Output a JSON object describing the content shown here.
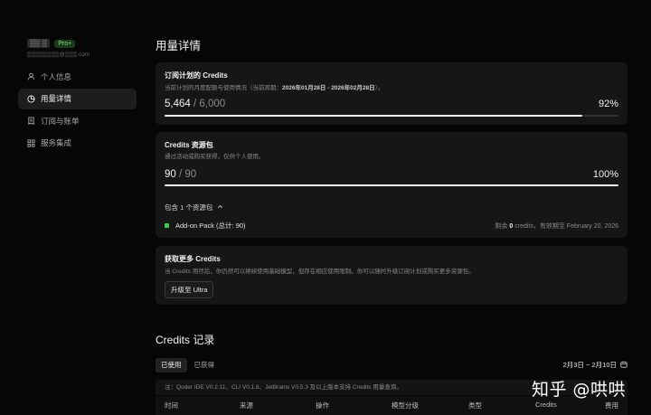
{
  "user": {
    "name": "▒▒ ▒",
    "plan_badge": "Pro+",
    "email": "▒▒▒▒▒▒▒▒@▒▒▒.com"
  },
  "nav": [
    {
      "label": "个人信息",
      "icon": "user-icon",
      "active": false
    },
    {
      "label": "用量详情",
      "icon": "pie-chart-icon",
      "active": true
    },
    {
      "label": "订阅与账单",
      "icon": "receipt-icon",
      "active": false
    },
    {
      "label": "服务集成",
      "icon": "grid-icon",
      "active": false
    }
  ],
  "page_title": "用量详情",
  "plan_card": {
    "title": "订阅计划的 Credits",
    "subtitle": "当前计划的月度配额与使用情况（当前周期：",
    "period": "2026年01月28日 - 2026年02月28日",
    "subtitle_end": "）。",
    "used": "5,464",
    "total": "/ 6,000",
    "percent": "92%",
    "progress": 0.92
  },
  "pack_card": {
    "title": "Credits 资源包",
    "subtitle": "通过活动或购买获得，仅供个人使用。",
    "used": "90",
    "total": "/ 90",
    "percent": "100%",
    "progress": 1.0,
    "toggle_label": "包含 1 个资源包",
    "pack_name": "Add-on Pack (总计: 90)",
    "remaining_prefix": "剩余",
    "remaining_value": "0",
    "remaining_suffix": "credits，有效期至 February 20, 2026"
  },
  "more_card": {
    "title": "获取更多 Credits",
    "subtitle": "当 Credits 用尽后，你仍然可以继续使用基础模型，但存在相应使用限制。你可以随时升级订阅计划或购买更多资源包。",
    "button": "升级至 Ultra"
  },
  "records": {
    "title": "Credits 记录",
    "tabs": [
      "已使用",
      "已获得"
    ],
    "active_tab": 0,
    "date_range": "2月3日 ~ 2月10日",
    "note": "注：Qoder IDE V0.2.11、CLI V0.1.8、JetBrains V0.5.3 及以上版本支持 Credits 用量查询。",
    "columns": [
      "时间",
      "来源",
      "操作",
      "模型分级",
      "类型",
      "Credits",
      "费用"
    ]
  },
  "watermark": "知乎 @哄哄"
}
